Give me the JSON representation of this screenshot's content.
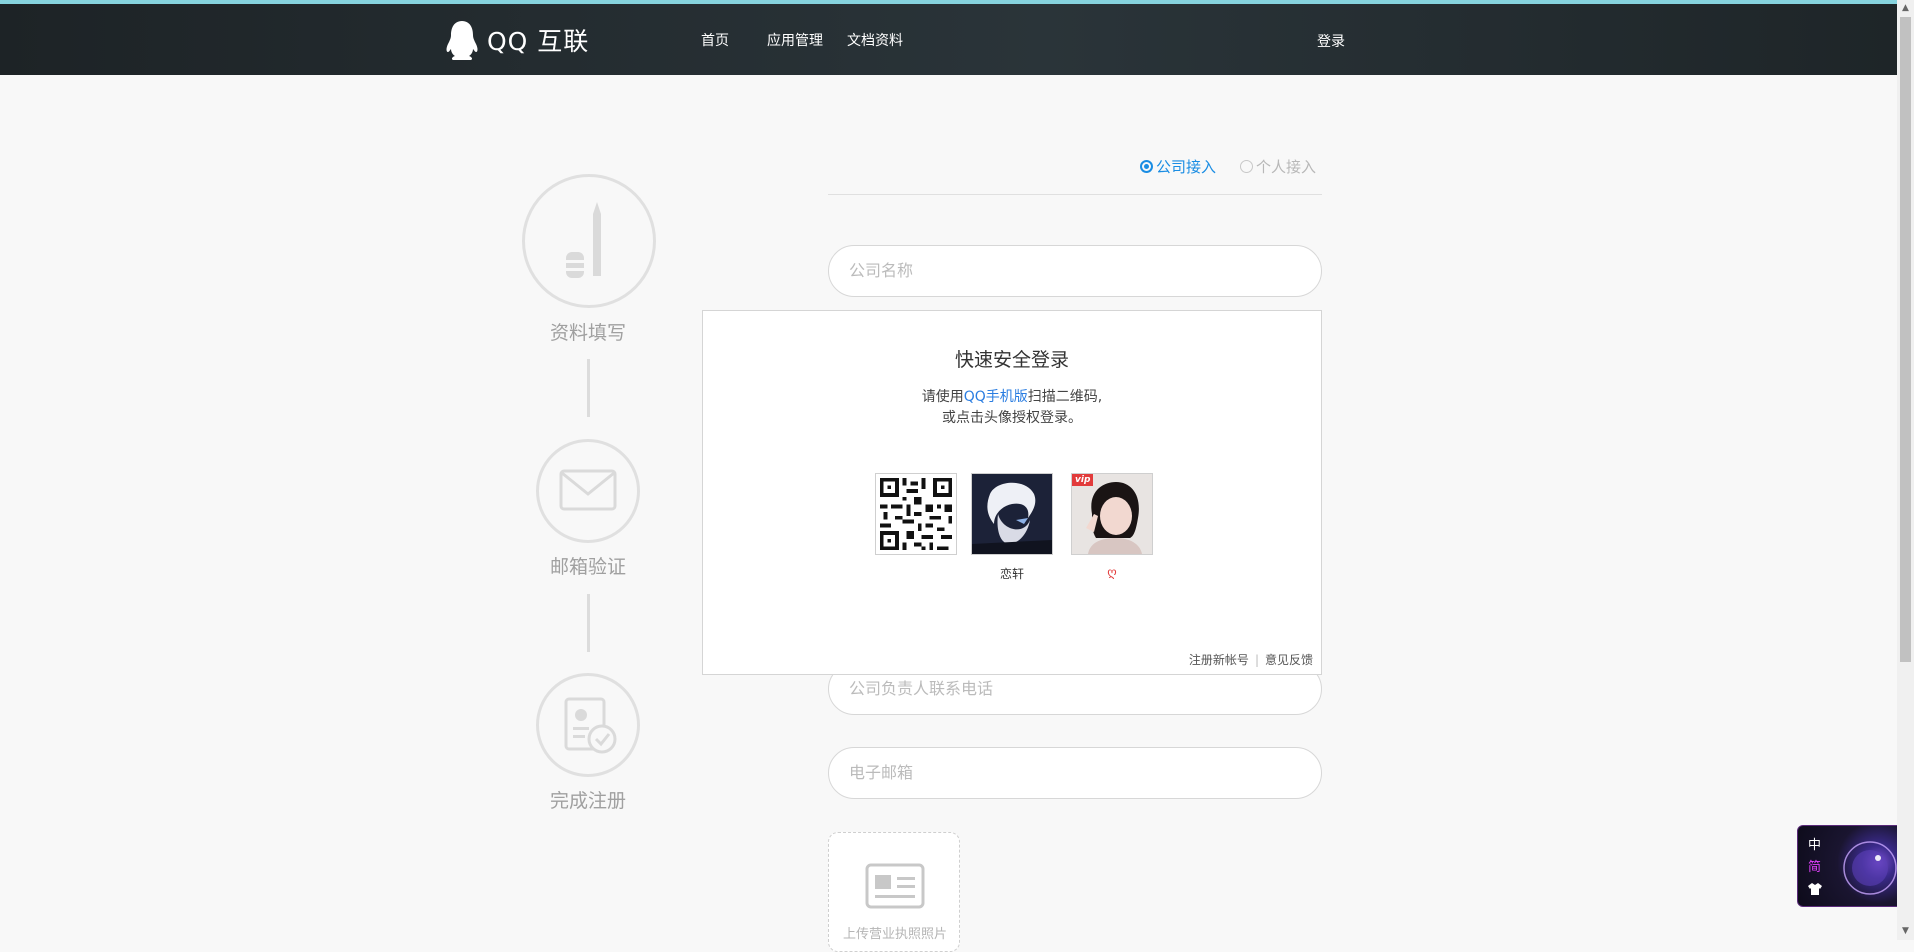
{
  "header": {
    "logo_text": "QQ 互联",
    "nav": [
      "首页",
      "应用管理",
      "文档资料"
    ],
    "login": "登录"
  },
  "steps": [
    {
      "label": "资料填写",
      "icon": "pen-icon"
    },
    {
      "label": "邮箱验证",
      "icon": "envelope-icon"
    },
    {
      "label": "完成注册",
      "icon": "id-card-check-icon"
    }
  ],
  "access_type": {
    "company": "公司接入",
    "personal": "个人接入",
    "selected": "company"
  },
  "form": {
    "company_name_placeholder": "公司名称",
    "phone_placeholder": "公司负责人联系电话",
    "email_placeholder": "电子邮箱",
    "upload_label": "上传营业执照照片"
  },
  "login_popup": {
    "title": "快速安全登录",
    "desc_prefix": "请使用",
    "desc_link": "QQ手机版",
    "desc_suffix": "扫描二维码,",
    "desc_line2": "或点击头像授权登录。",
    "accounts": [
      {
        "name": "恋轩"
      },
      {
        "name": "ღ",
        "badge": "vip"
      }
    ],
    "footer_register": "注册新帐号",
    "footer_separator": "|",
    "footer_feedback": "意见反馈"
  },
  "widget": {
    "chars": [
      "中",
      "简"
    ]
  },
  "colors": {
    "accent": "#1a8de3",
    "header_bg": "#242c30",
    "link": "#2a7de1"
  }
}
